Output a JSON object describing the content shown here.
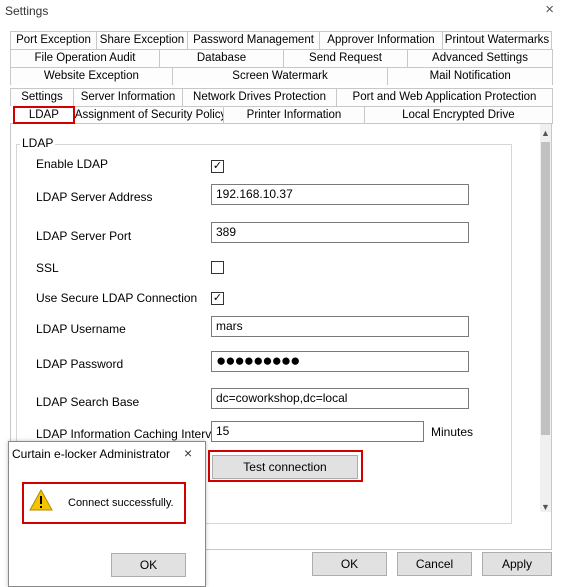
{
  "window": {
    "title": "Settings",
    "close_glyph": "×"
  },
  "tabs": {
    "row1": [
      "Port Exception",
      "Share Exception",
      "Password Management",
      "Approver Information",
      "Printout Watermarks"
    ],
    "row2": [
      "File Operation Audit",
      "Database",
      "Send Request",
      "Advanced Settings"
    ],
    "row3": [
      "Website Exception",
      "Screen Watermark",
      "Mail Notification"
    ],
    "row4": [
      "Settings",
      "Server Information",
      "Network Drives Protection",
      "Port and Web Application Protection"
    ],
    "row5": [
      "LDAP",
      "Assignment of Security Policy",
      "Printer Information",
      "Local Encrypted Drive"
    ],
    "selected": "LDAP"
  },
  "ldap": {
    "group_title": "LDAP",
    "enable_label": "Enable LDAP",
    "enable_checked": true,
    "server_address_label": "LDAP Server Address",
    "server_address": "192.168.10.37",
    "server_port_label": "LDAP Server Port",
    "server_port": "389",
    "ssl_label": "SSL",
    "ssl_checked": false,
    "secure_label": "Use Secure LDAP Connection",
    "secure_checked": true,
    "username_label": "LDAP Username",
    "username": "mars",
    "password_label": "LDAP Password",
    "password_mask": "●●●●●●●●●",
    "search_base_label": "LDAP Search Base",
    "search_base": "dc=coworkshop,dc=local",
    "cache_label": "LDAP Information Caching Interval",
    "cache_value": "15",
    "cache_unit": "Minutes",
    "test_button": "Test connection"
  },
  "checkmark": "✓",
  "footer": {
    "ok": "OK",
    "cancel": "Cancel",
    "apply": "Apply"
  },
  "scrollbar": {
    "up": "▲",
    "down": "▼"
  },
  "dialog": {
    "title": "Curtain e-locker Administrator",
    "close_glyph": "×",
    "message": "Connect successfully.",
    "ok": "OK",
    "icon": "warning-icon"
  },
  "colors": {
    "highlight": "#d40000",
    "button_bg": "#e1e1e1",
    "warning_yellow": "#f5c400"
  }
}
